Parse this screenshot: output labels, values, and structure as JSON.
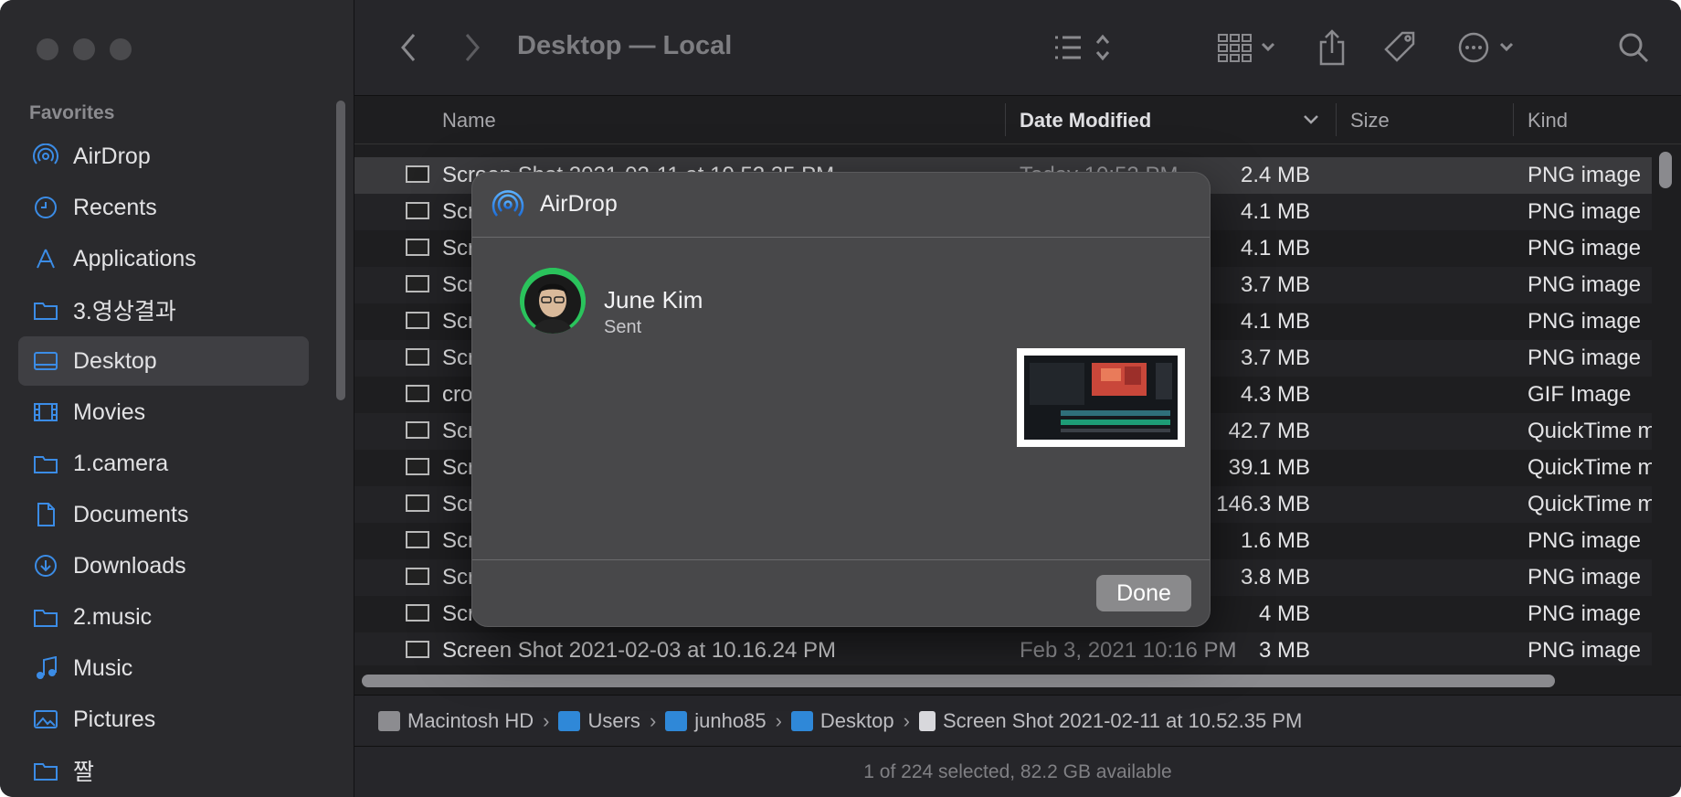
{
  "sidebar": {
    "heading": "Favorites",
    "items": [
      {
        "label": "AirDrop",
        "icon": "airdrop-icon"
      },
      {
        "label": "Recents",
        "icon": "clock-icon"
      },
      {
        "label": "Applications",
        "icon": "applications-icon"
      },
      {
        "label": "3.영상결과",
        "icon": "folder-icon"
      },
      {
        "label": "Desktop",
        "icon": "desktop-icon",
        "active": true
      },
      {
        "label": "Movies",
        "icon": "film-icon"
      },
      {
        "label": "1.camera",
        "icon": "folder-icon"
      },
      {
        "label": "Documents",
        "icon": "document-icon"
      },
      {
        "label": "Downloads",
        "icon": "download-icon"
      },
      {
        "label": "2.music",
        "icon": "folder-icon"
      },
      {
        "label": "Music",
        "icon": "music-icon"
      },
      {
        "label": "Pictures",
        "icon": "pictures-icon"
      },
      {
        "label": "짤",
        "icon": "folder-icon"
      }
    ]
  },
  "toolbar": {
    "title": "Desktop — Local"
  },
  "columns": {
    "name": "Name",
    "date": "Date Modified",
    "size": "Size",
    "kind": "Kind"
  },
  "files": [
    {
      "name": "Screen Shot 2021-02-11 at 10.52.35 PM",
      "date": "Today 10:52 PM",
      "size": "2.4 MB",
      "kind": "PNG image"
    },
    {
      "name": "Scr",
      "date": "M",
      "size": "4.1 MB",
      "kind": "PNG image"
    },
    {
      "name": "Scr",
      "date": "PM",
      "size": "4.1 MB",
      "kind": "PNG image"
    },
    {
      "name": "Scr",
      "date": "PM",
      "size": "3.7 MB",
      "kind": "PNG image"
    },
    {
      "name": "Scr",
      "date": "PM",
      "size": "4.1 MB",
      "kind": "PNG image"
    },
    {
      "name": "Scr",
      "date": "PM",
      "size": "3.7 MB",
      "kind": "PNG image"
    },
    {
      "name": "cro",
      "date": "PM",
      "size": "4.3 MB",
      "kind": "GIF Image"
    },
    {
      "name": "Scr",
      "date": "PM",
      "size": "42.7 MB",
      "kind": "QuickTime m"
    },
    {
      "name": "Scr",
      "date": "PM",
      "size": "39.1 MB",
      "kind": "QuickTime m"
    },
    {
      "name": "Scr",
      "date": "PM",
      "size": "146.3 MB",
      "kind": "QuickTime m"
    },
    {
      "name": "Scr",
      "date": "PM",
      "size": "1.6 MB",
      "kind": "PNG image"
    },
    {
      "name": "Scr",
      "date": "PM",
      "size": "3.8 MB",
      "kind": "PNG image"
    },
    {
      "name": "Scr",
      "date": "PM",
      "size": "4 MB",
      "kind": "PNG image"
    },
    {
      "name": "Screen Shot 2021-02-03 at 10.16.24 PM",
      "date": "Feb 3, 2021 10:16 PM",
      "size": "3 MB",
      "kind": "PNG image"
    }
  ],
  "path": [
    "Macintosh HD",
    "Users",
    "junho85",
    "Desktop",
    "Screen Shot 2021-02-11 at 10.52.35 PM"
  ],
  "status": "1 of 224 selected, 82.2 GB available",
  "dialog": {
    "title": "AirDrop",
    "person_name": "June Kim",
    "person_status": "Sent",
    "done_label": "Done"
  }
}
